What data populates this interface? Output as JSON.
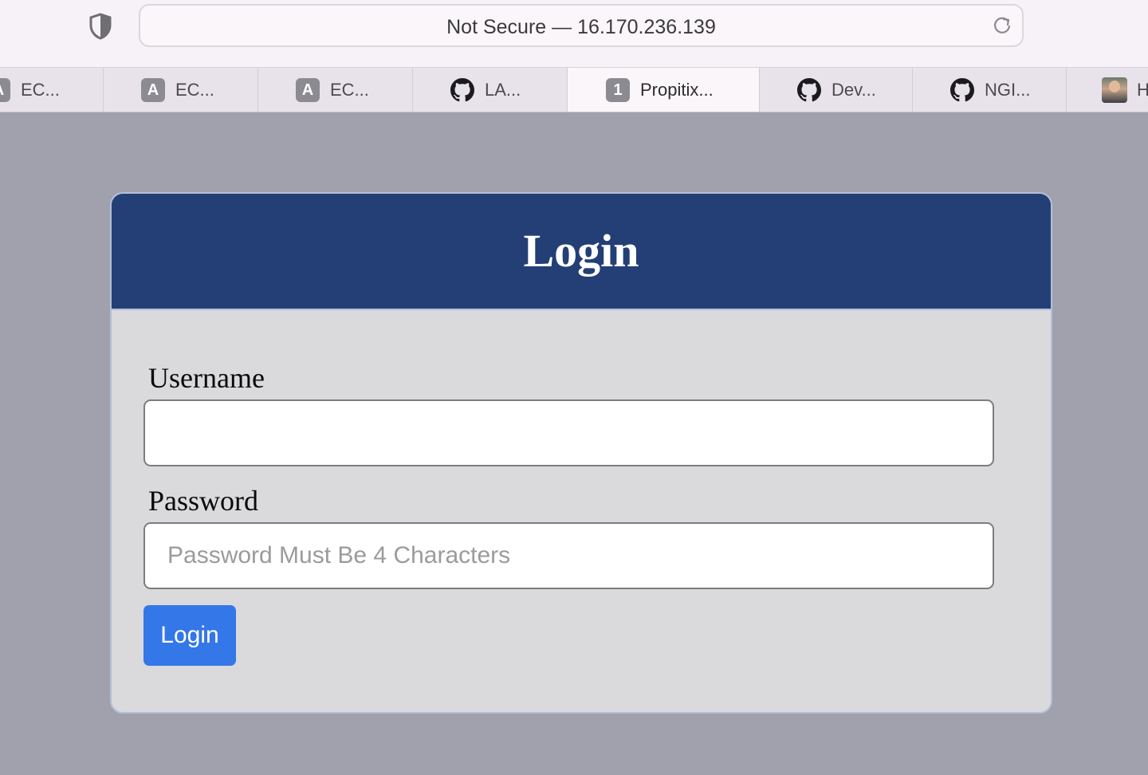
{
  "browser": {
    "address": "Not Secure — 16.170.236.139",
    "tabs": [
      {
        "icon": "a-badge-icon",
        "icon_text": "A",
        "label": "EC..."
      },
      {
        "icon": "a-badge-icon",
        "icon_text": "A",
        "label": "EC..."
      },
      {
        "icon": "a-badge-icon",
        "icon_text": "A",
        "label": "EC..."
      },
      {
        "icon": "github-icon",
        "label": "LA..."
      },
      {
        "icon": "number-badge-icon",
        "icon_text": "1",
        "label": "Propitix...",
        "active": true
      },
      {
        "icon": "github-icon",
        "label": "Dev..."
      },
      {
        "icon": "github-icon",
        "label": "NGI..."
      },
      {
        "icon": "avatar-icon",
        "label": "H"
      }
    ]
  },
  "login": {
    "title": "Login",
    "username_label": "Username",
    "username_value": "",
    "password_label": "Password",
    "password_placeholder": "Password Must Be 4 Characters",
    "submit_label": "Login"
  },
  "colors": {
    "page_background": "#a0a1ac",
    "header_background": "#233f76",
    "card_background": "#dad9dc",
    "button_background": "#3477e8"
  }
}
